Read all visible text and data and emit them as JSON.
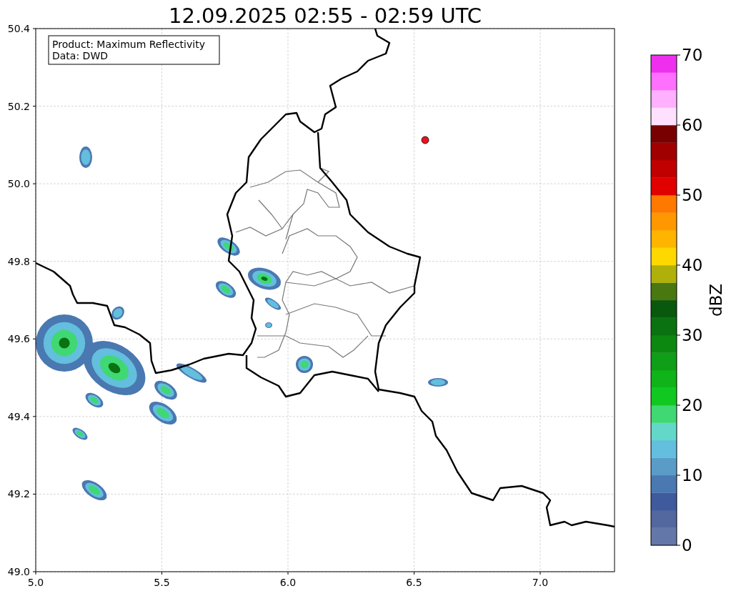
{
  "title": "12.09.2025 02:55 - 02:59 UTC",
  "map": {
    "info_box": [
      "Product: Maximum Reflectivity",
      "Data: DWD"
    ],
    "xticks": [
      "5.0",
      "5.5",
      "6.0",
      "6.5",
      "7.0"
    ],
    "yticks": [
      "50.4",
      "50.2",
      "50.0",
      "49.8",
      "49.6",
      "49.4",
      "49.2",
      "49.0"
    ]
  },
  "colorbar": {
    "label": "dBZ",
    "ticks": [
      "70",
      "60",
      "50",
      "40",
      "30",
      "20",
      "10",
      "0"
    ],
    "bands": [
      {
        "color": "#6477a9"
      },
      {
        "color": "#52689f"
      },
      {
        "color": "#405a9e"
      },
      {
        "color": "#4a78b0"
      },
      {
        "color": "#5a9cc8"
      },
      {
        "color": "#64bede"
      },
      {
        "color": "#64d8c8"
      },
      {
        "color": "#3fd873"
      },
      {
        "color": "#10c820"
      },
      {
        "color": "#0fb418"
      },
      {
        "color": "#0e9e18"
      },
      {
        "color": "#0c8810"
      },
      {
        "color": "#0a7210"
      },
      {
        "color": "#08580e"
      },
      {
        "color": "#4a7810"
      },
      {
        "color": "#b0b00a"
      },
      {
        "color": "#ffd800"
      },
      {
        "color": "#ffb400"
      },
      {
        "color": "#ff9800"
      },
      {
        "color": "#ff7800"
      },
      {
        "color": "#e00000"
      },
      {
        "color": "#c00000"
      },
      {
        "color": "#a00000"
      },
      {
        "color": "#780000"
      },
      {
        "color": "#ffe0ff"
      },
      {
        "color": "#ffb0ff"
      },
      {
        "color": "#ff70ff"
      },
      {
        "color": "#ee30ee"
      }
    ]
  }
}
